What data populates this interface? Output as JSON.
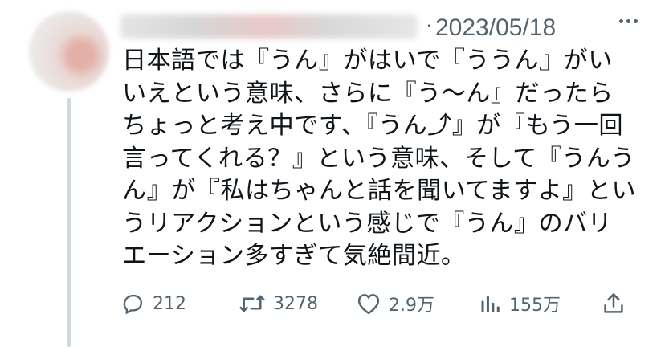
{
  "tweet": {
    "date": "2023/05/18",
    "separator": "·",
    "text": "日本語では『うん』がはいで『ううん』がいいえという意味、さらに『う〜ん』だったらちょっと考え中です、『うん⤴』が『もう一回言ってくれる？』という意味、そして『うんうん』が『私はちゃんと話を聞いてますよ』というリアクションという感じで『うん』のバリエーション多すぎて気絶間近。"
  },
  "actions": {
    "reply": {
      "icon": "reply-icon",
      "count": "212"
    },
    "retweet": {
      "icon": "retweet-icon",
      "count": "3278"
    },
    "like": {
      "icon": "heart-icon",
      "count": "2.9万"
    },
    "views": {
      "icon": "views-chart-icon",
      "count": "155万"
    },
    "share": {
      "icon": "share-icon"
    }
  },
  "colors": {
    "text": "#0f1419",
    "muted": "#536471",
    "thread_line": "#cfd9de"
  }
}
